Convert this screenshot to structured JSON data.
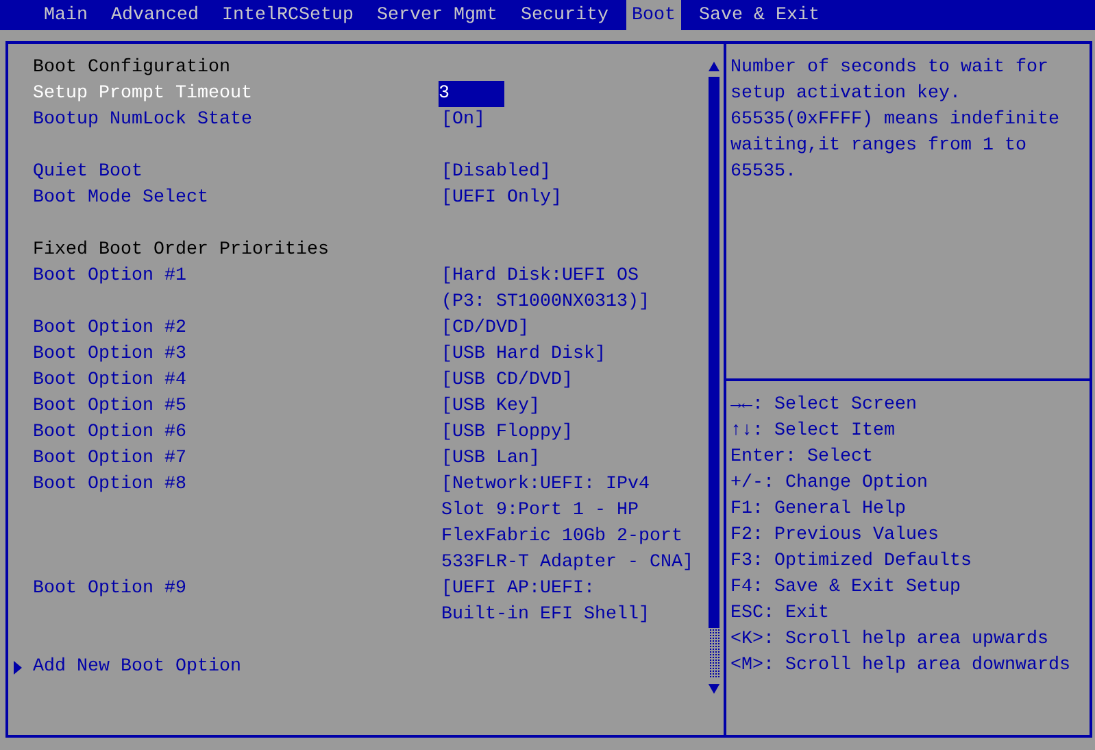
{
  "tabs": [
    {
      "label": "Main",
      "selected": false
    },
    {
      "label": "Advanced",
      "selected": false
    },
    {
      "label": "IntelRCSetup",
      "selected": false
    },
    {
      "label": "Server Mgmt",
      "selected": false
    },
    {
      "label": "Security",
      "selected": false
    },
    {
      "label": "Boot",
      "selected": true
    },
    {
      "label": "Save & Exit",
      "selected": false
    }
  ],
  "settings": [
    {
      "kind": "heading",
      "label": "Boot Configuration",
      "gap_before": false
    },
    {
      "kind": "setting",
      "label": "Setup Prompt Timeout",
      "value": [
        "3"
      ],
      "gap_before": false,
      "selected": true
    },
    {
      "kind": "setting",
      "label": "Bootup NumLock State",
      "value": [
        "[On]"
      ],
      "gap_before": false,
      "selected": false
    },
    {
      "kind": "setting",
      "label": "Quiet Boot",
      "value": [
        "[Disabled]"
      ],
      "gap_before": true,
      "selected": false
    },
    {
      "kind": "setting",
      "label": "Boot Mode Select",
      "value": [
        "[UEFI Only]"
      ],
      "gap_before": false,
      "selected": false
    },
    {
      "kind": "heading",
      "label": "Fixed Boot Order Priorities",
      "gap_before": true
    },
    {
      "kind": "setting",
      "label": "Boot Option #1",
      "value": [
        "[Hard Disk:UEFI OS",
        "(P3: ST1000NX0313)]"
      ],
      "gap_before": false,
      "selected": false
    },
    {
      "kind": "setting",
      "label": "Boot Option #2",
      "value": [
        "[CD/DVD]"
      ],
      "gap_before": false,
      "selected": false
    },
    {
      "kind": "setting",
      "label": "Boot Option #3",
      "value": [
        "[USB Hard Disk]"
      ],
      "gap_before": false,
      "selected": false
    },
    {
      "kind": "setting",
      "label": "Boot Option #4",
      "value": [
        "[USB CD/DVD]"
      ],
      "gap_before": false,
      "selected": false
    },
    {
      "kind": "setting",
      "label": "Boot Option #5",
      "value": [
        "[USB Key]"
      ],
      "gap_before": false,
      "selected": false
    },
    {
      "kind": "setting",
      "label": "Boot Option #6",
      "value": [
        "[USB Floppy]"
      ],
      "gap_before": false,
      "selected": false
    },
    {
      "kind": "setting",
      "label": "Boot Option #7",
      "value": [
        "[USB Lan]"
      ],
      "gap_before": false,
      "selected": false
    },
    {
      "kind": "setting",
      "label": "Boot Option #8",
      "value": [
        "[Network:UEFI: IPv4",
        "Slot 9:Port 1 - HP",
        "FlexFabric 10Gb 2-port",
        "533FLR-T Adapter - CNA]"
      ],
      "gap_before": false,
      "selected": false
    },
    {
      "kind": "setting",
      "label": "Boot Option #9",
      "value": [
        "[UEFI AP:UEFI:",
        "Built-in EFI Shell]"
      ],
      "gap_before": false,
      "selected": false
    },
    {
      "kind": "submenu",
      "label": "Add New Boot Option",
      "gap_before": true,
      "selected": false
    }
  ],
  "help_text": "Number of seconds to wait for setup activation key. 65535(0xFFFF) means indefinite waiting,it ranges from 1 to 65535.",
  "key_help": [
    "→←: Select Screen",
    "↑↓: Select Item",
    "Enter: Select",
    "+/-: Change Option",
    "F1: General Help",
    "F2: Previous Values",
    "F3: Optimized Defaults",
    "F4: Save & Exit Setup",
    "ESC: Exit",
    "<K>: Scroll help area upwards",
    "<M>: Scroll help area downwards"
  ]
}
